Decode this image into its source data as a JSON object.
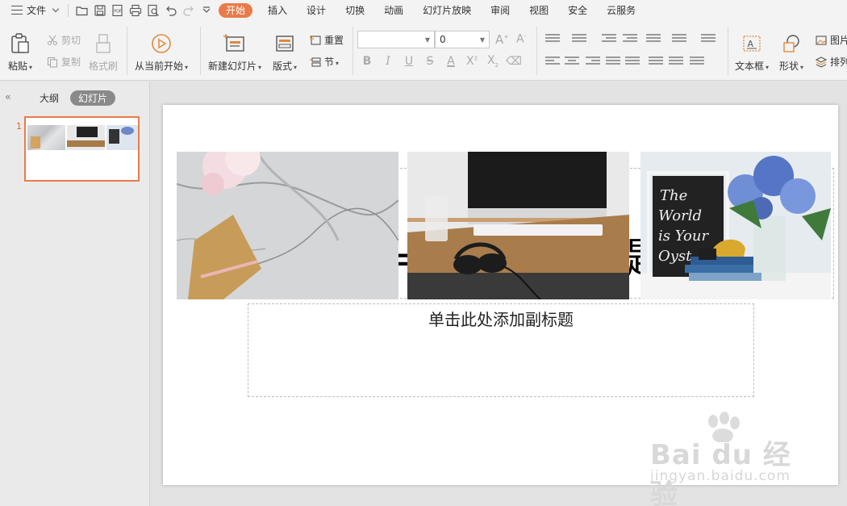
{
  "menu": {
    "file_label": "文件",
    "tabs": [
      {
        "label": "开始",
        "active": true
      },
      {
        "label": "插入"
      },
      {
        "label": "设计"
      },
      {
        "label": "切换"
      },
      {
        "label": "动画"
      },
      {
        "label": "幻灯片放映"
      },
      {
        "label": "审阅"
      },
      {
        "label": "视图"
      },
      {
        "label": "安全"
      },
      {
        "label": "云服务"
      }
    ],
    "active_color": "#e97b49"
  },
  "ribbon": {
    "paste": "粘贴",
    "cut": "剪切",
    "copy": "复制",
    "format_painter": "格式刷",
    "play_from_current": "从当前开始",
    "new_slide": "新建幻灯片",
    "layout": "版式",
    "reset": "重置",
    "section": "节",
    "font_name_value": "",
    "font_size_value": "0",
    "textbox": "文本框",
    "shapes": "形状",
    "picture": "图片",
    "arrange": "排列"
  },
  "left_panel": {
    "tab_outline": "大纲",
    "tab_slides": "幻灯片",
    "slide_number": "1"
  },
  "slide": {
    "subtitle_placeholder": "单击此处添加副标题",
    "title_glyph_left": "=",
    "title_glyph_right": "题"
  },
  "watermark": {
    "logo": "Bai du 经验",
    "url": "jingyan.baidu.com"
  }
}
